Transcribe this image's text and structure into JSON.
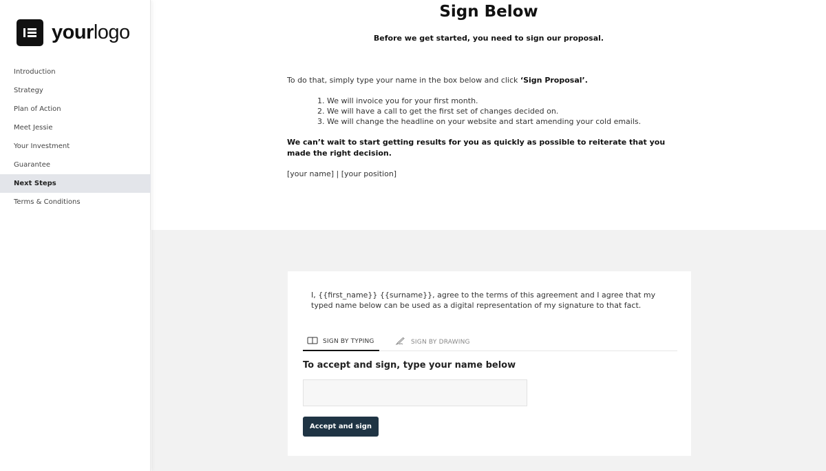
{
  "sidebar": {
    "logo": {
      "bold": "your",
      "light": "logo"
    },
    "items": [
      {
        "label": "Introduction"
      },
      {
        "label": "Strategy"
      },
      {
        "label": "Plan of Action"
      },
      {
        "label": "Meet Jessie"
      },
      {
        "label": "Your Investment"
      },
      {
        "label": "Guarantee"
      },
      {
        "label": "Next Steps",
        "active": true
      },
      {
        "label": "Terms & Conditions"
      }
    ]
  },
  "main": {
    "title": "Sign Below",
    "subtitle": "Before we get started, you need to sign our proposal.",
    "intro_prefix": "To do that, simply type your name in the box below and click ",
    "intro_bold": "‘Sign Proposal’.",
    "steps": [
      "1. We will invoice you for your first month.",
      "2. We will have a call to get the first set of changes decided on.",
      "3. We will change the headline on your website and start amending your cold emails."
    ],
    "closing": "We can’t wait to start getting results for you as quickly as possible to reiterate that you made the right decision.",
    "signature_placeholder": "[your name] | [your position]"
  },
  "sign_card": {
    "agreement": "I, {{first_name}} {{surname}}, agree to the terms of this agreement and I agree that my typed name below can be used as a digital representation of my signature to that fact.",
    "tabs": [
      {
        "label": "SIGN BY TYPING",
        "icon": "keyboard-icon",
        "active": true
      },
      {
        "label": "SIGN BY DRAWING",
        "icon": "pen-icon",
        "active": false
      }
    ],
    "accept_label": "To accept and sign, type your name below",
    "name_input": {
      "value": "",
      "placeholder": ""
    },
    "button_label": "Accept and sign"
  },
  "colors": {
    "button_bg": "#1f3444",
    "active_nav_bg": "#e3e5ea",
    "lower_panel_bg": "#f2f2f2"
  }
}
